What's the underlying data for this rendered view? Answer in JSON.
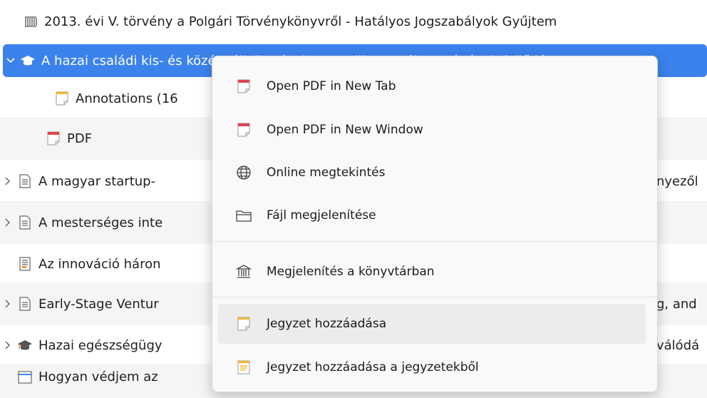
{
  "rows": [
    {
      "label": "2013. évi V. törvény a Polgári Törvénykönyvről - Hatályos Jogszabályok Gyűjtem",
      "icon": "library-icon"
    },
    {
      "label": "A hazai családi kis- és középvállalkozások controlling tevékenységének fejlődé",
      "icon": "graduation-cap-icon",
      "selected": true
    },
    {
      "label": "Annotations (16",
      "icon": "note-icon"
    },
    {
      "label": "PDF",
      "icon": "pdf-icon"
    },
    {
      "label": "A magyar startup-",
      "suffix": "nyezől",
      "icon": "document-icon"
    },
    {
      "label": "A mesterséges inte",
      "icon": "document-icon"
    },
    {
      "label": "Az innováció háron",
      "icon": "report-icon"
    },
    {
      "label": "Early-Stage Ventur",
      "suffix": "g, and",
      "icon": "document-icon"
    },
    {
      "label": "Hazai egészségügy",
      "suffix": "válódá",
      "icon": "graduation-cap-icon"
    },
    {
      "label": "Hogyan védjem az",
      "icon": "webpage-icon"
    }
  ],
  "menu": {
    "items": [
      {
        "label": "Open PDF in New Tab",
        "icon": "pdf-icon"
      },
      {
        "label": "Open PDF in New Window",
        "icon": "pdf-icon"
      },
      {
        "label": "Online megtekintés",
        "icon": "globe-icon"
      },
      {
        "label": "Fájl megjelenítése",
        "icon": "folder-icon"
      },
      {
        "label": "Megjelenítés a könyvtárban",
        "icon": "library-icon"
      },
      {
        "label": "Jegyzet hozzáadása",
        "icon": "note-icon",
        "hover": true
      },
      {
        "label": "Jegyzet hozzáadása a jegyzetekből",
        "icon": "note-lines-icon"
      }
    ]
  },
  "colors": {
    "selection": "#3b82ec",
    "pdf_red": "#e0454f",
    "note_yellow": "#f5b731"
  }
}
